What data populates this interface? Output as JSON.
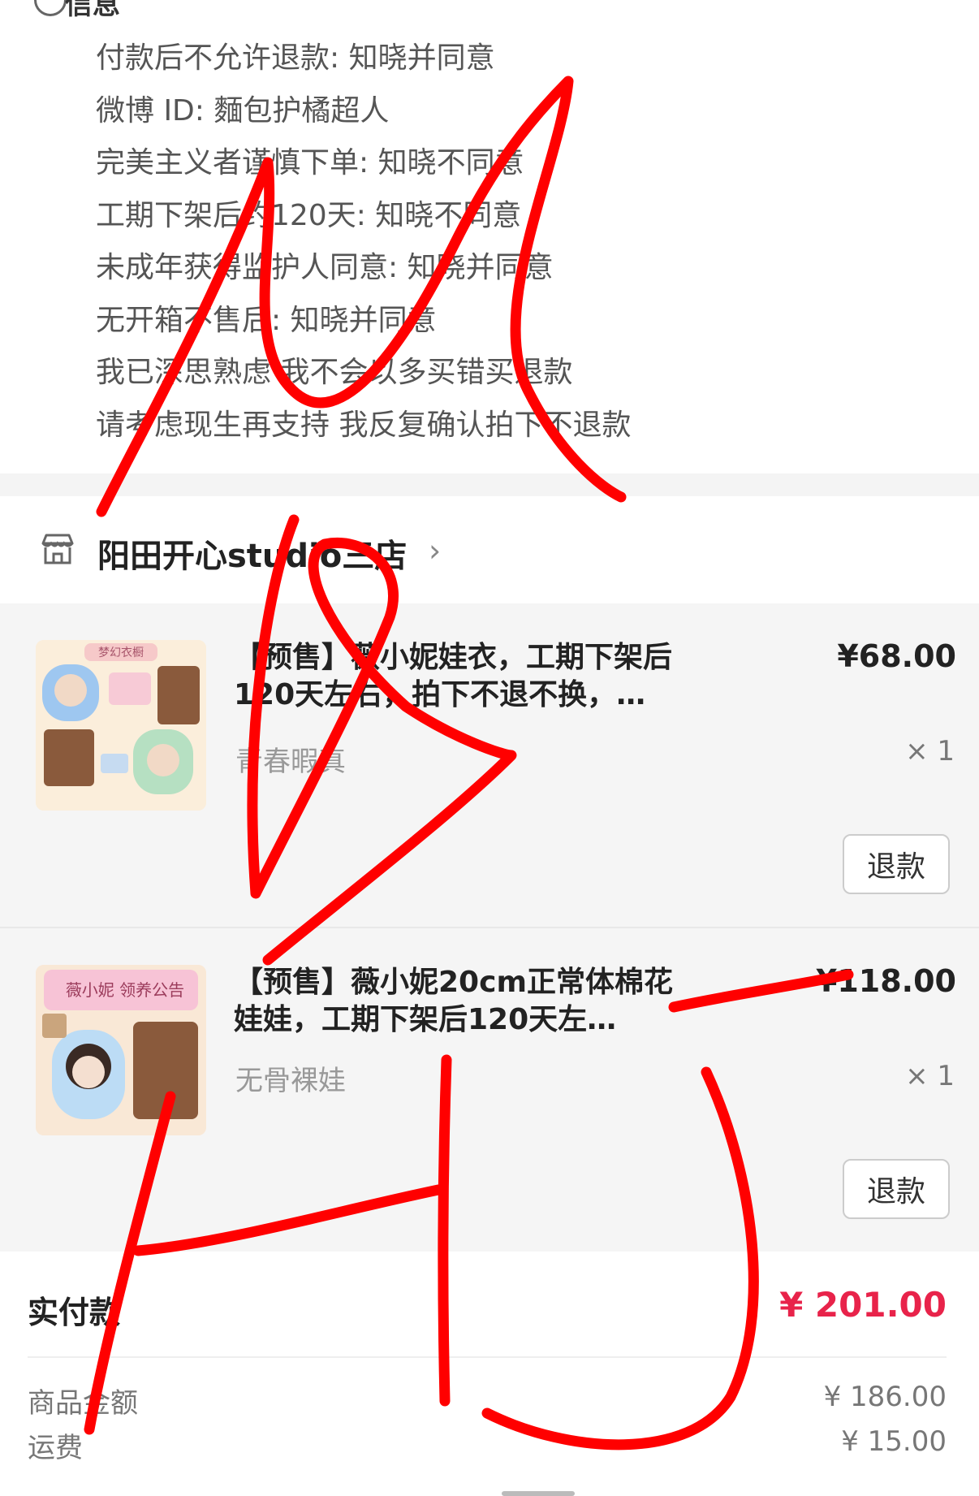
{
  "notes": {
    "section_title": "信息",
    "lines": [
      "付款后不允许退款: 知晓并同意",
      "微博 ID: 麵包护橘超人",
      "完美主义者谨慎下单: 知晓不同意",
      "工期下架后约120天: 知晓不同意",
      "未成年获得监护人同意: 知晓并同意",
      "无开箱不售后: 知晓并同意",
      "我已深思熟虑 我不会以多买错买退款",
      "请考虑现生再支持 我反复确认拍下不退款"
    ]
  },
  "store": {
    "name": "阳田开心studio三店",
    "chevron": "›"
  },
  "items": [
    {
      "title": "【预售】薇小妮娃衣，工期下架后120天左右，拍下不退不换，…",
      "spec": "青春暇真",
      "price": "¥68.00",
      "qty": "× 1",
      "refund_label": "退款",
      "thumb_caption": "梦幻衣橱"
    },
    {
      "title": "【预售】薇小妮20cm正常体棉花娃娃，工期下架后120天左…",
      "spec": "无骨裸娃",
      "price": "¥118.00",
      "qty": "× 1",
      "refund_label": "退款",
      "thumb_caption": "薇小妮 领养公告"
    }
  ],
  "summary": {
    "paid_label": "实付款",
    "paid_value": "¥ 201.00",
    "goods_label": "商品金额",
    "goods_value": "¥ 186.00",
    "shipping_label": "运费",
    "shipping_value": "¥ 15.00"
  },
  "colors": {
    "accent_red": "#e8234a",
    "scribble_red": "#ff0000",
    "item_bg": "#f5f5f5"
  }
}
